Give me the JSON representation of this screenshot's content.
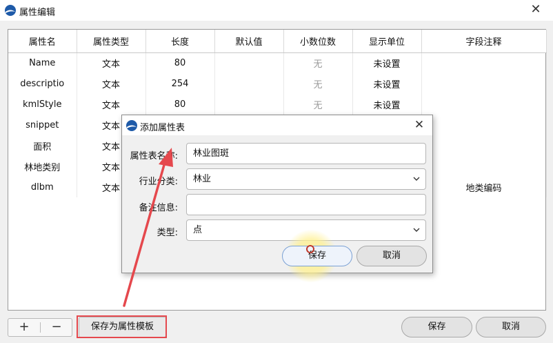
{
  "window": {
    "title": "属性编辑",
    "close_glyph": "✕"
  },
  "table": {
    "columns": [
      "属性名",
      "属性类型",
      "长度",
      "默认值",
      "小数位数",
      "显示单位",
      "字段注释"
    ],
    "rows": [
      {
        "name": "Name",
        "type": "文本",
        "length": "80",
        "default": "",
        "decimals": "无",
        "unit": "未设置",
        "comment": ""
      },
      {
        "name": "descriptio",
        "type": "文本",
        "length": "254",
        "default": "",
        "decimals": "无",
        "unit": "未设置",
        "comment": ""
      },
      {
        "name": "kmlStyle",
        "type": "文本",
        "length": "80",
        "default": "",
        "decimals": "无",
        "unit": "未设置",
        "comment": ""
      },
      {
        "name": "snippet",
        "type": "文本",
        "length": "",
        "default": "",
        "decimals": "",
        "unit": "",
        "comment": ""
      },
      {
        "name": "面积",
        "type": "文本",
        "length": "",
        "default": "",
        "decimals": "",
        "unit": "",
        "comment": ""
      },
      {
        "name": "林地类别",
        "type": "文本",
        "length": "",
        "default": "",
        "decimals": "",
        "unit": "",
        "comment": ""
      },
      {
        "name": "dlbm",
        "type": "文本",
        "length": "",
        "default": "",
        "decimals": "",
        "unit": "",
        "comment": "地类编码"
      }
    ]
  },
  "bottom": {
    "add_glyph": "+",
    "remove_glyph": "−",
    "save_template_label": "保存为属性模板",
    "save_label": "保存",
    "cancel_label": "取消"
  },
  "dialog": {
    "title": "添加属性表",
    "close_glyph": "✕",
    "name_label": "属性表名称:",
    "name_value": "林业图斑",
    "industry_label": "行业分类:",
    "industry_value": "林业",
    "note_label": "备注信息:",
    "note_value": "",
    "type_label": "类型:",
    "type_value": "点",
    "save_label": "保存",
    "cancel_label": "取消"
  },
  "colors": {
    "annotation_red": "#e5484d",
    "logo_blue": "#1e5aa8"
  }
}
